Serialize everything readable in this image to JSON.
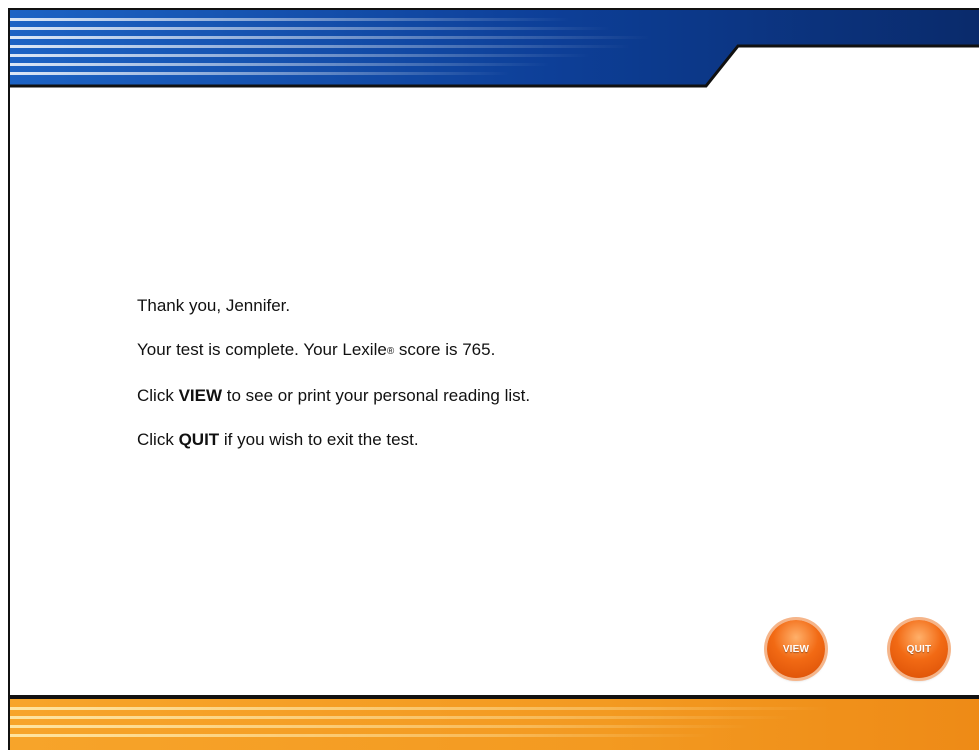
{
  "messages": {
    "thanks_line": "Thank you, Jennifer.",
    "score_prefix": "Your test is complete.  Your Lexile",
    "reg_mark": "®",
    "score_suffix": " score is 765.",
    "view_prefix": "Click ",
    "view_word": "VIEW",
    "view_suffix": " to see or print your personal reading list.",
    "quit_prefix": "Click ",
    "quit_word": "QUIT",
    "quit_suffix": " if you wish to exit the test."
  },
  "buttons": {
    "view_label": "VIEW",
    "quit_label": "QUIT"
  },
  "colors": {
    "banner_blue": "#1f5fb3",
    "banner_dark": "#0b2f75",
    "banner_orange": "#f39a21",
    "button_orange": "#f26a14"
  }
}
